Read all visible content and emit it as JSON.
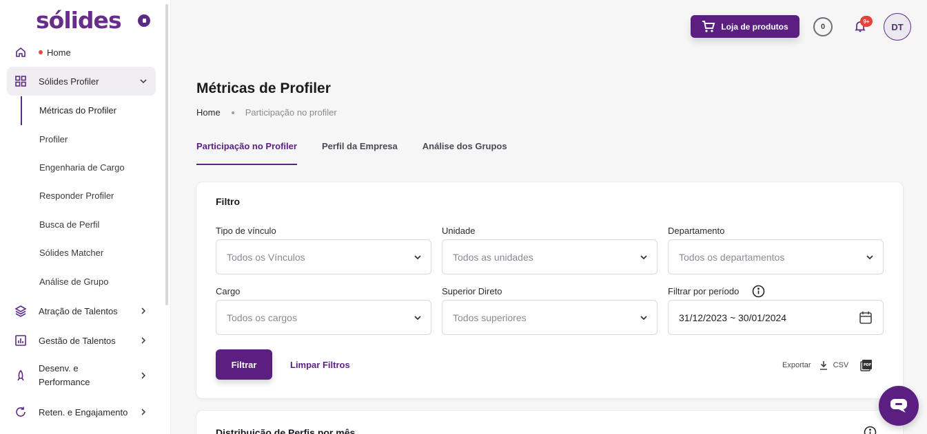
{
  "sidebar": {
    "logo_text": "sólides",
    "home": {
      "label": "Home"
    },
    "profiler_group": {
      "label": "Sólides Profiler"
    },
    "sub_items": [
      {
        "label": "Métricas do Profiler"
      },
      {
        "label": "Profiler"
      },
      {
        "label": "Engenharia de Cargo"
      },
      {
        "label": "Responder Profiler"
      },
      {
        "label": "Busca de Perfil"
      },
      {
        "label": "Sólides Matcher"
      },
      {
        "label": "Análise de Grupo"
      }
    ],
    "groups": [
      {
        "label": "Atração de Talentos"
      },
      {
        "label": "Gestão de Talentos"
      },
      {
        "label_line1": "Desenv. e",
        "label_line2": "Performance"
      },
      {
        "label": "Reten. e Engajamento"
      }
    ]
  },
  "header": {
    "store_label": "Loja de produtos",
    "coins": "0",
    "notifications_badge": "9+",
    "avatar_initials": "DT"
  },
  "page": {
    "title": "Métricas de Profiler",
    "breadcrumb": {
      "home": "Home",
      "current": "Participação no profiler"
    },
    "tabs": [
      {
        "label": "Participação no Profiler"
      },
      {
        "label": "Perfil da Empresa"
      },
      {
        "label": "Análise dos Grupos"
      }
    ]
  },
  "filter": {
    "title": "Filtro",
    "fields": {
      "vinculo": {
        "label": "Tipo de vínculo",
        "placeholder": "Todos os Vínculos"
      },
      "unidade": {
        "label": "Unidade",
        "placeholder": "Todos as unidades"
      },
      "departamento": {
        "label": "Departamento",
        "placeholder": "Todos os departamentos"
      },
      "cargo": {
        "label": "Cargo",
        "placeholder": "Todos os cargos"
      },
      "superior": {
        "label": "Superior Direto",
        "placeholder": "Todos superiores"
      },
      "periodo": {
        "label": "Filtrar por período",
        "value": "31/12/2023 ~ 30/01/2024"
      }
    },
    "filter_button": "Filtrar",
    "clear_button": "Limpar Filtros",
    "export_label": "Exportar",
    "csv_label": "CSV"
  },
  "distribution_card": {
    "title": "Distribuição de Perfis por mês"
  },
  "colors": {
    "brand": "#5b1f82",
    "badge": "#e8413c"
  }
}
